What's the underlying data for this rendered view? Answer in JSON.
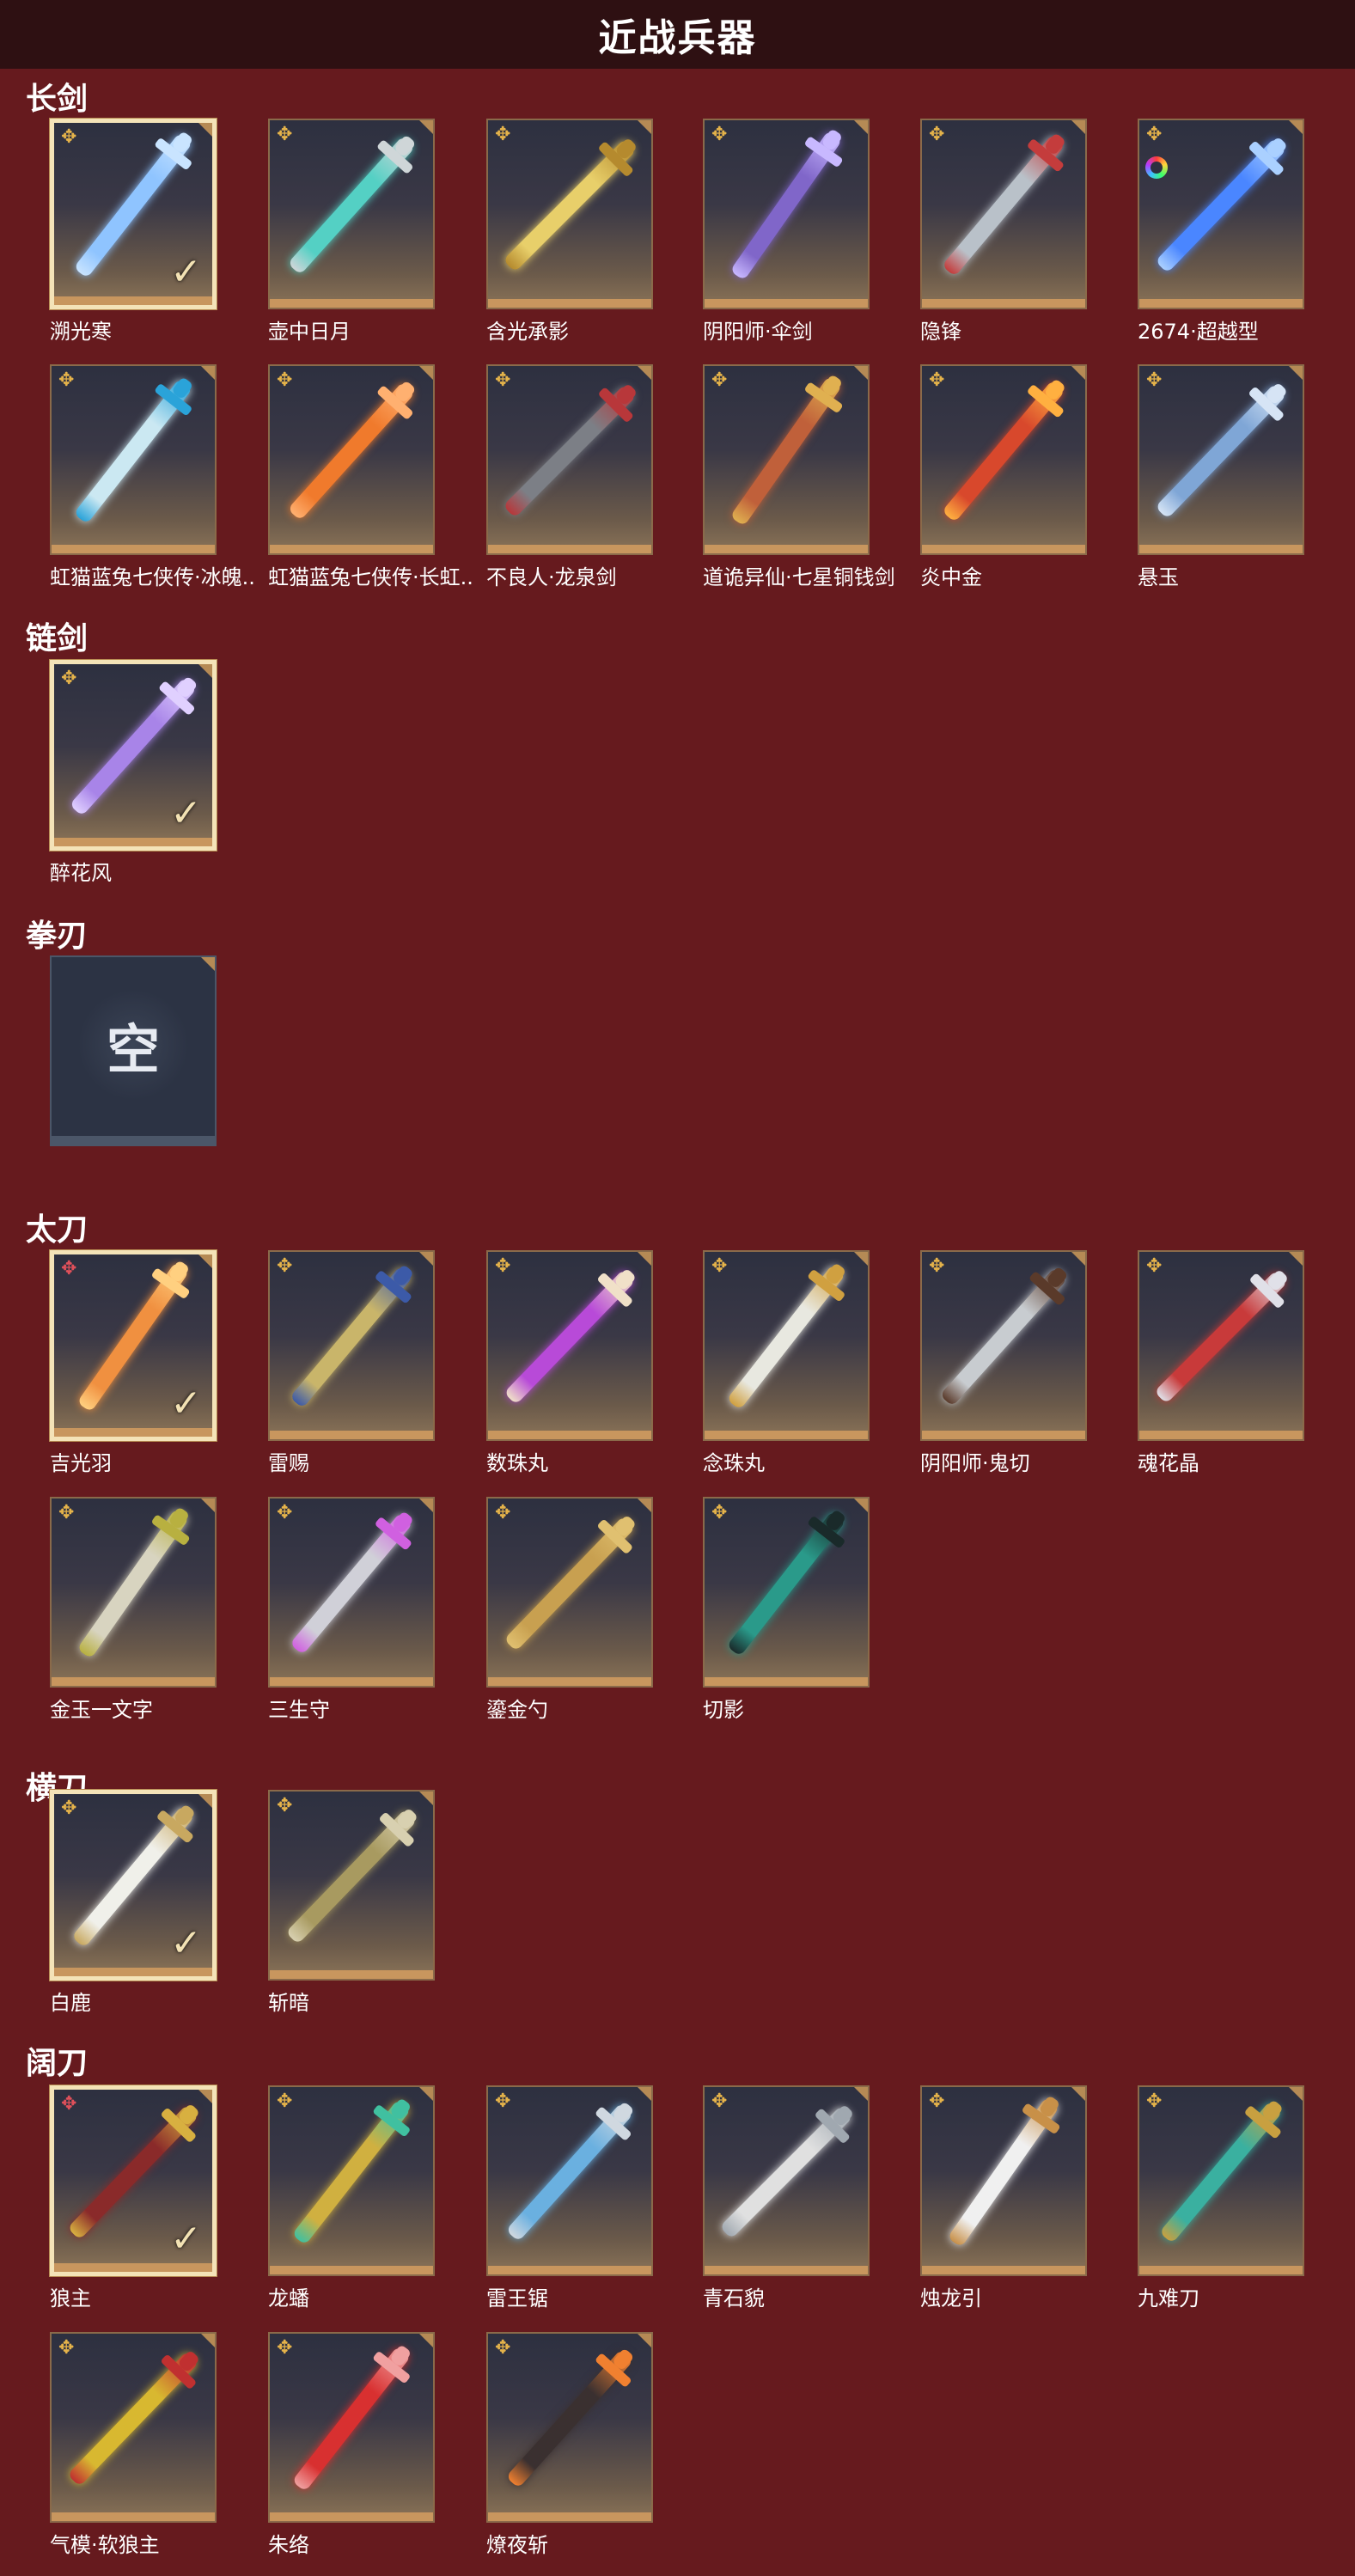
{
  "page_title": "近战兵器",
  "empty_text": "空",
  "colors": {
    "background": "#661a1e",
    "title_bar": "#2e1012",
    "rarity_gold": "#e5b34a",
    "rarity_red": "#e0505a",
    "selected_border": "#f4e3b8"
  },
  "categories": [
    {
      "name": "长剑",
      "items": [
        {
          "name": "溯光寒",
          "rarity": "gold",
          "selected": true,
          "blade": "#8fc4ff",
          "accent": "#c9e4ff"
        },
        {
          "name": "壶中日月",
          "rarity": "gold",
          "selected": false,
          "blade": "#54d0c4",
          "accent": "#cfd6d8"
        },
        {
          "name": "含光承影",
          "rarity": "gold",
          "selected": false,
          "blade": "#e8cf6a",
          "accent": "#b58a2e"
        },
        {
          "name": "阴阳师·伞剑",
          "rarity": "gold",
          "selected": false,
          "blade": "#8066c9",
          "accent": "#c8b8ff"
        },
        {
          "name": "隐锋",
          "rarity": "gold",
          "selected": false,
          "blade": "#b9c1c9",
          "accent": "#c43c3c"
        },
        {
          "name": "2674·超越型",
          "rarity": "gold",
          "selected": false,
          "ring": true,
          "blade": "#4a86ff",
          "accent": "#aad0ff"
        },
        {
          "name": "虹猫蓝兔七侠传·冰魄..",
          "rarity": "gold",
          "selected": false,
          "blade": "#cbe8f2",
          "accent": "#2aa3d9"
        },
        {
          "name": "虹猫蓝兔七侠传·长虹..",
          "rarity": "gold",
          "selected": false,
          "blade": "#f07a2c",
          "accent": "#ffb070"
        },
        {
          "name": "不良人·龙泉剑",
          "rarity": "gold",
          "selected": false,
          "blade": "#7c7f86",
          "accent": "#b8373a"
        },
        {
          "name": "道诡异仙·七星铜钱剑",
          "rarity": "gold",
          "selected": false,
          "blade": "#c0603a",
          "accent": "#e0b050"
        },
        {
          "name": "炎中金",
          "rarity": "gold",
          "selected": false,
          "blade": "#d8482c",
          "accent": "#ffb040"
        },
        {
          "name": "悬玉",
          "rarity": "gold",
          "selected": false,
          "blade": "#7fa6d6",
          "accent": "#d6e4f5"
        }
      ]
    },
    {
      "name": "链剑",
      "items": [
        {
          "name": "醉花风",
          "rarity": "gold",
          "selected": true,
          "blade": "#a884e8",
          "accent": "#e0d0ff"
        }
      ]
    },
    {
      "name": "拳刃",
      "items": [
        {
          "name": "",
          "rarity": "none",
          "selected": false,
          "empty": true
        }
      ]
    },
    {
      "name": "太刀",
      "items": [
        {
          "name": "吉光羽",
          "rarity": "red",
          "selected": true,
          "blade": "#f09040",
          "accent": "#ffd080"
        },
        {
          "name": "雷赐",
          "rarity": "gold",
          "selected": false,
          "blade": "#c9b56a",
          "accent": "#3c5aa8"
        },
        {
          "name": "数珠丸",
          "rarity": "gold",
          "selected": false,
          "blade": "#b84ad8",
          "accent": "#f0e0c8"
        },
        {
          "name": "念珠丸",
          "rarity": "gold",
          "selected": false,
          "blade": "#e8e8e0",
          "accent": "#d0a040"
        },
        {
          "name": "阴阳师·鬼切",
          "rarity": "gold",
          "selected": false,
          "blade": "#c8ccd0",
          "accent": "#5a3a2a"
        },
        {
          "name": "魂花晶",
          "rarity": "gold",
          "selected": false,
          "blade": "#c83a3a",
          "accent": "#e0e0e8"
        },
        {
          "name": "金玉一文字",
          "rarity": "gold",
          "selected": false,
          "blade": "#d8d4c0",
          "accent": "#b8b040"
        },
        {
          "name": "三生守",
          "rarity": "gold",
          "selected": false,
          "blade": "#d0d0d8",
          "accent": "#d060e0"
        },
        {
          "name": "鎏金勺",
          "rarity": "gold",
          "selected": false,
          "blade": "#c8a050",
          "accent": "#e0c070"
        },
        {
          "name": "切影",
          "rarity": "gold",
          "selected": false,
          "blade": "#2a9a8a",
          "accent": "#1a2a2a"
        }
      ]
    },
    {
      "name": "横刀",
      "items": [
        {
          "name": "白鹿",
          "rarity": "gold",
          "selected": true,
          "blade": "#f0f0ea",
          "accent": "#c8a860"
        },
        {
          "name": "斩暗",
          "rarity": "gold",
          "selected": false,
          "blade": "#a89a60",
          "accent": "#d8d0b0"
        }
      ]
    },
    {
      "name": "阔刀",
      "items": [
        {
          "name": "狼主",
          "rarity": "red",
          "selected": true,
          "blade": "#8a2a2a",
          "accent": "#d8b040"
        },
        {
          "name": "龙蟠",
          "rarity": "gold",
          "selected": false,
          "blade": "#d0b040",
          "accent": "#40c0a0"
        },
        {
          "name": "雷王锯",
          "rarity": "gold",
          "selected": false,
          "blade": "#6ab0e0",
          "accent": "#d0d8e0"
        },
        {
          "name": "青石貌",
          "rarity": "gold",
          "selected": false,
          "blade": "#e0e0e0",
          "accent": "#a0a8b0"
        },
        {
          "name": "烛龙引",
          "rarity": "gold",
          "selected": false,
          "blade": "#f0f0f0",
          "accent": "#c89048"
        },
        {
          "name": "九难刀",
          "rarity": "gold",
          "selected": false,
          "blade": "#3ab0a0",
          "accent": "#c8a040"
        },
        {
          "name": "气模·软狼主",
          "rarity": "gold",
          "selected": false,
          "blade": "#d8b830",
          "accent": "#c03030"
        },
        {
          "name": "朱络",
          "rarity": "gold",
          "selected": false,
          "blade": "#d83030",
          "accent": "#f0a0a0"
        },
        {
          "name": "燎夜斩",
          "rarity": "gold",
          "selected": false,
          "blade": "#3a3030",
          "accent": "#f08030"
        }
      ]
    }
  ]
}
